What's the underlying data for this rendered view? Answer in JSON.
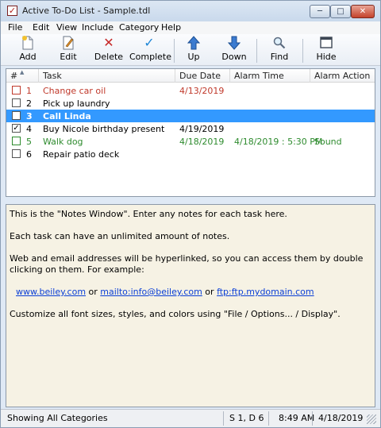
{
  "window": {
    "title": "Active To-Do List - Sample.tdl",
    "app_icon": "checkbox-icon",
    "controls": {
      "minimize": "─",
      "maximize": "□",
      "close": "✕"
    }
  },
  "menu": [
    "File",
    "Edit",
    "View",
    "Include",
    "Category",
    "Help"
  ],
  "toolbar": {
    "add": "Add",
    "edit": "Edit",
    "delete": "Delete",
    "complete": "Complete",
    "up": "Up",
    "down": "Down",
    "find": "Find",
    "hide": "Hide"
  },
  "columns": {
    "num": "#",
    "task": "Task",
    "due": "Due Date",
    "alarm": "Alarm Time",
    "action": "Alarm Action"
  },
  "tasks": [
    {
      "num": "1",
      "task": "Change car oil",
      "due": "4/13/2019",
      "alarm": "",
      "action": "",
      "checked": false,
      "color": "#c0392b"
    },
    {
      "num": "2",
      "task": "Pick up laundry",
      "due": "",
      "alarm": "",
      "action": "",
      "checked": false,
      "color": "#000000"
    },
    {
      "num": "3",
      "task": "Call Linda",
      "due": "",
      "alarm": "",
      "action": "",
      "checked": false,
      "color": "#ffffff",
      "selected": true
    },
    {
      "num": "4",
      "task": "Buy Nicole birthday present",
      "due": "4/19/2019",
      "alarm": "",
      "action": "",
      "checked": true,
      "color": "#000000"
    },
    {
      "num": "5",
      "task": "Walk dog",
      "due": "4/18/2019",
      "alarm": "4/18/2019 : 5:30 PM",
      "action": "Sound",
      "checked": false,
      "color": "#2e8b2e"
    },
    {
      "num": "6",
      "task": "Repair patio deck",
      "due": "",
      "alarm": "",
      "action": "",
      "checked": false,
      "color": "#000000"
    }
  ],
  "notes": {
    "p1": "This is the \"Notes Window\".  Enter any notes for each task here.",
    "p2": "Each task can have an unlimited amount of notes.",
    "p3": "Web and email addresses will be hyperlinked, so you can access them by double clicking on them.  For example:",
    "link1": "www.beiley.com",
    "or1": " or ",
    "link2": "mailto:info@beiley.com",
    "or2": " or ",
    "link3": "ftp:ftp.mydomain.com",
    "p4": "Customize all font sizes, styles, and colors using \"File / Options... / Display\"."
  },
  "status": {
    "categories": "Showing All Categories",
    "position": "S 1, D 6",
    "time": "8:49 AM",
    "date": "4/18/2019"
  },
  "colors": {
    "selection": "#3399ff",
    "notes_bg": "#f6f2e4",
    "overdue": "#c0392b",
    "alarm": "#2e8b2e"
  }
}
